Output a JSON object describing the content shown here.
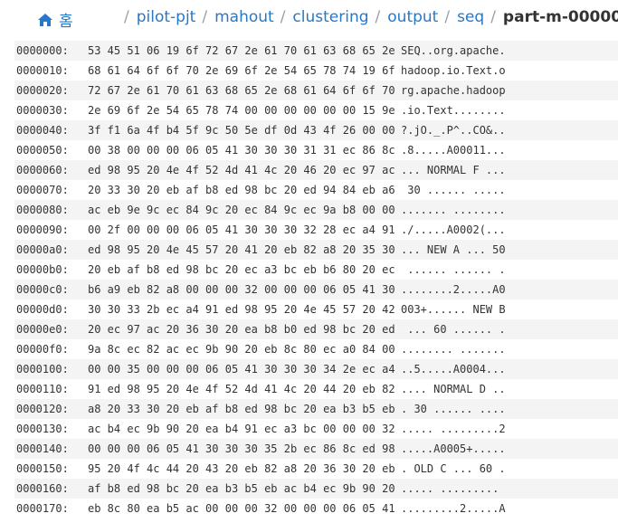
{
  "breadcrumb": {
    "home_label": "홈",
    "path": [
      "pilot-pjt",
      "mahout",
      "clustering",
      "output",
      "seq"
    ],
    "current": "part-m-00000"
  },
  "dump": {
    "rows": [
      {
        "offset": "0000000:",
        "hex": "53 45 51 06 19 6f 72 67 2e 61 70 61 63 68 65 2e",
        "ascii": "SEQ..org.apache."
      },
      {
        "offset": "0000010:",
        "hex": "68 61 64 6f 6f 70 2e 69 6f 2e 54 65 78 74 19 6f",
        "ascii": "hadoop.io.Text.o"
      },
      {
        "offset": "0000020:",
        "hex": "72 67 2e 61 70 61 63 68 65 2e 68 61 64 6f 6f 70",
        "ascii": "rg.apache.hadoop"
      },
      {
        "offset": "0000030:",
        "hex": "2e 69 6f 2e 54 65 78 74 00 00 00 00 00 00 15 9e",
        "ascii": ".io.Text........"
      },
      {
        "offset": "0000040:",
        "hex": "3f f1 6a 4f b4 5f 9c 50 5e df 0d 43 4f 26 00 00",
        "ascii": "?.jO._.P^..CO&.."
      },
      {
        "offset": "0000050:",
        "hex": "00 38 00 00 00 06 05 41 30 30 30 31 31 ec 86 8c",
        "ascii": ".8.....A00011..."
      },
      {
        "offset": "0000060:",
        "hex": "ed 98 95 20 4e 4f 52 4d 41 4c 20 46 20 ec 97 ac",
        "ascii": "... NORMAL F ..."
      },
      {
        "offset": "0000070:",
        "hex": "20 33 30 20 eb af b8 ed 98 bc 20 ed 94 84 eb a6",
        "ascii": " 30 ...... ....."
      },
      {
        "offset": "0000080:",
        "hex": "ac eb 9e 9c ec 84 9c 20 ec 84 9c ec 9a b8 00 00",
        "ascii": "....... ........"
      },
      {
        "offset": "0000090:",
        "hex": "00 2f 00 00 00 06 05 41 30 30 30 32 28 ec a4 91",
        "ascii": "./.....A0002(..."
      },
      {
        "offset": "00000a0:",
        "hex": "ed 98 95 20 4e 45 57 20 41 20 eb 82 a8 20 35 30",
        "ascii": "... NEW A ... 50"
      },
      {
        "offset": "00000b0:",
        "hex": "20 eb af b8 ed 98 bc 20 ec a3 bc eb b6 80 20 ec",
        "ascii": " ...... ...... ."
      },
      {
        "offset": "00000c0:",
        "hex": "b6 a9 eb 82 a8 00 00 00 32 00 00 00 06 05 41 30",
        "ascii": "........2.....A0"
      },
      {
        "offset": "00000d0:",
        "hex": "30 30 33 2b ec a4 91 ed 98 95 20 4e 45 57 20 42",
        "ascii": "003+...... NEW B"
      },
      {
        "offset": "00000e0:",
        "hex": "20 ec 97 ac 20 36 30 20 ea b8 b0 ed 98 bc 20 ed",
        "ascii": " ... 60 ...... ."
      },
      {
        "offset": "00000f0:",
        "hex": "9a 8c ec 82 ac ec 9b 90 20 eb 8c 80 ec a0 84 00",
        "ascii": "........ ......."
      },
      {
        "offset": "0000100:",
        "hex": "00 00 35 00 00 00 06 05 41 30 30 30 34 2e ec a4",
        "ascii": "..5.....A0004..."
      },
      {
        "offset": "0000110:",
        "hex": "91 ed 98 95 20 4e 4f 52 4d 41 4c 20 44 20 eb 82",
        "ascii": ".... NORMAL D .."
      },
      {
        "offset": "0000120:",
        "hex": "a8 20 33 30 20 eb af b8 ed 98 bc 20 ea b3 b5 eb",
        "ascii": ". 30 ...... ...."
      },
      {
        "offset": "0000130:",
        "hex": "ac b4 ec 9b 90 20 ea b4 91 ec a3 bc 00 00 00 32",
        "ascii": "..... .........2"
      },
      {
        "offset": "0000140:",
        "hex": "00 00 00 06 05 41 30 30 30 35 2b ec 86 8c ed 98",
        "ascii": ".....A0005+....."
      },
      {
        "offset": "0000150:",
        "hex": "95 20 4f 4c 44 20 43 20 eb 82 a8 20 36 30 20 eb",
        "ascii": ". OLD C ... 60 ."
      },
      {
        "offset": "0000160:",
        "hex": "af b8 ed 98 bc 20 ea b3 b5 eb ac b4 ec 9b 90 20",
        "ascii": "..... ......... "
      },
      {
        "offset": "0000170:",
        "hex": "eb 8c 80 ea b5 ac 00 00 00 32 00 00 00 06 05 41",
        "ascii": ".........2.....A"
      }
    ]
  }
}
